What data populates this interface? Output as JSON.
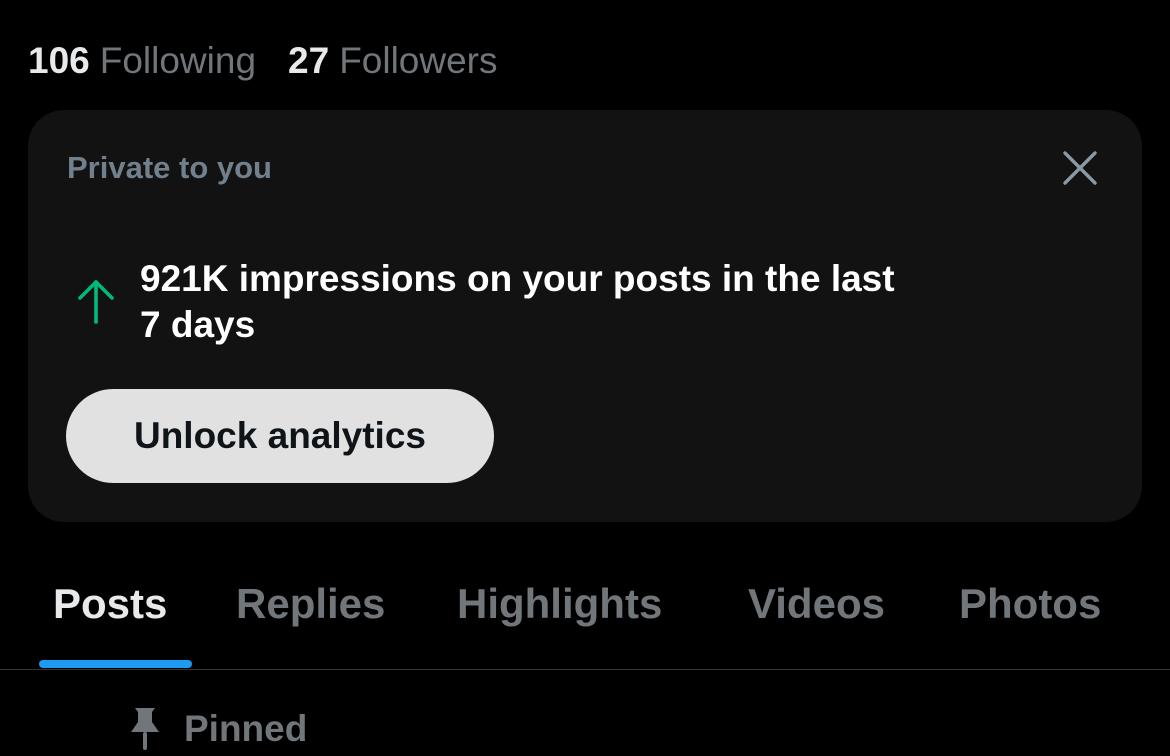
{
  "profile": {
    "following_count": "106",
    "following_label": "Following",
    "followers_count": "27",
    "followers_label": "Followers"
  },
  "analytics_card": {
    "kicker": "Private to you",
    "insight_line1": "921K impressions on your posts in the last",
    "insight_line2": "7 days",
    "trend_icon": "arrow-up-icon",
    "trend_color": "#00ba7c",
    "close_icon": "close-icon",
    "button_label": "Unlock analytics"
  },
  "tabs": [
    {
      "label": "Posts",
      "active": true
    },
    {
      "label": "Replies",
      "active": false
    },
    {
      "label": "Highlights",
      "active": false
    },
    {
      "label": "Videos",
      "active": false
    },
    {
      "label": "Photos",
      "active": false
    }
  ],
  "pinned": {
    "icon": "pin-icon",
    "label": "Pinned"
  },
  "colors": {
    "accent": "#1d9bf0",
    "background": "#000000",
    "card_background": "#121212",
    "muted_text": "#71767b"
  }
}
